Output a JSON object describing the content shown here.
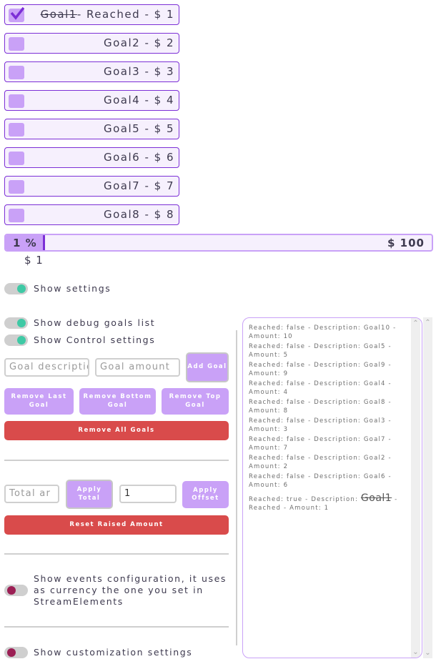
{
  "goals": [
    {
      "description": "Goal1",
      "suffix": "- Reached - $ 1",
      "reached": true
    },
    {
      "description": "Goal2",
      "suffix": " - $ 2",
      "reached": false
    },
    {
      "description": "Goal3",
      "suffix": " - $ 3",
      "reached": false
    },
    {
      "description": "Goal4",
      "suffix": " - $ 4",
      "reached": false
    },
    {
      "description": "Goal5",
      "suffix": " - $ 5",
      "reached": false
    },
    {
      "description": "Goal6",
      "suffix": " - $ 6",
      "reached": false
    },
    {
      "description": "Goal7",
      "suffix": " - $ 7",
      "reached": false
    },
    {
      "description": "Goal8",
      "suffix": " - $ 8",
      "reached": false
    }
  ],
  "progress": {
    "percent_label": "1 %",
    "percent": 1,
    "total_label": "$ 100",
    "raised_label": "$ 1"
  },
  "toggles": {
    "show_settings": {
      "label": "Show settings",
      "on": true
    },
    "show_debug": {
      "label": "Show debug goals list",
      "on": true
    },
    "show_control": {
      "label": "Show Control settings",
      "on": true
    },
    "show_events": {
      "label": "Show events configuration, it uses as currency the one you set in StreamElements",
      "on": false
    },
    "show_customization": {
      "label": "Show customization settings",
      "on": false
    }
  },
  "controls": {
    "goal_description_placeholder": "Goal descriptio",
    "goal_amount_placeholder": "Goal amount",
    "add_goal": "Add Goal",
    "remove_last": "Remove Last Goal",
    "remove_bottom": "Remove Bottom Goal",
    "remove_top": "Remove Top Goal",
    "remove_all": "Remove All Goals",
    "total_placeholder": "Total ar",
    "apply_total": "Apply Total",
    "offset_value": "1",
    "apply_offset": "Apply Offset",
    "reset_raised": "Reset Raised Amount"
  },
  "debug_list": [
    "Reached: false - Description: Goal10 - Amount: 10",
    "Reached: false - Description: Goal5 - Amount: 5",
    "Reached: false - Description: Goal9 - Amount: 9",
    "Reached: false - Description: Goal4 - Amount: 4",
    "Reached: false - Description: Goal8 - Amount: 8",
    "Reached: false - Description: Goal3 - Amount: 3",
    "Reached: false - Description: Goal7 - Amount: 7",
    "Reached: false - Description: Goal2 - Amount: 2",
    "Reached: false - Description: Goal6 - Amount: 6"
  ],
  "debug_last": {
    "prefix": "Reached: true - Description: ",
    "desc": "Goal1",
    "suffix": " - Reached - Amount: 1"
  },
  "colors": {
    "accent": "#7c2fd6",
    "light_accent": "#c9a1f7",
    "danger": "#d94b4b",
    "toggle_on": "#3fc9a5",
    "toggle_off": "#9b1f54"
  }
}
